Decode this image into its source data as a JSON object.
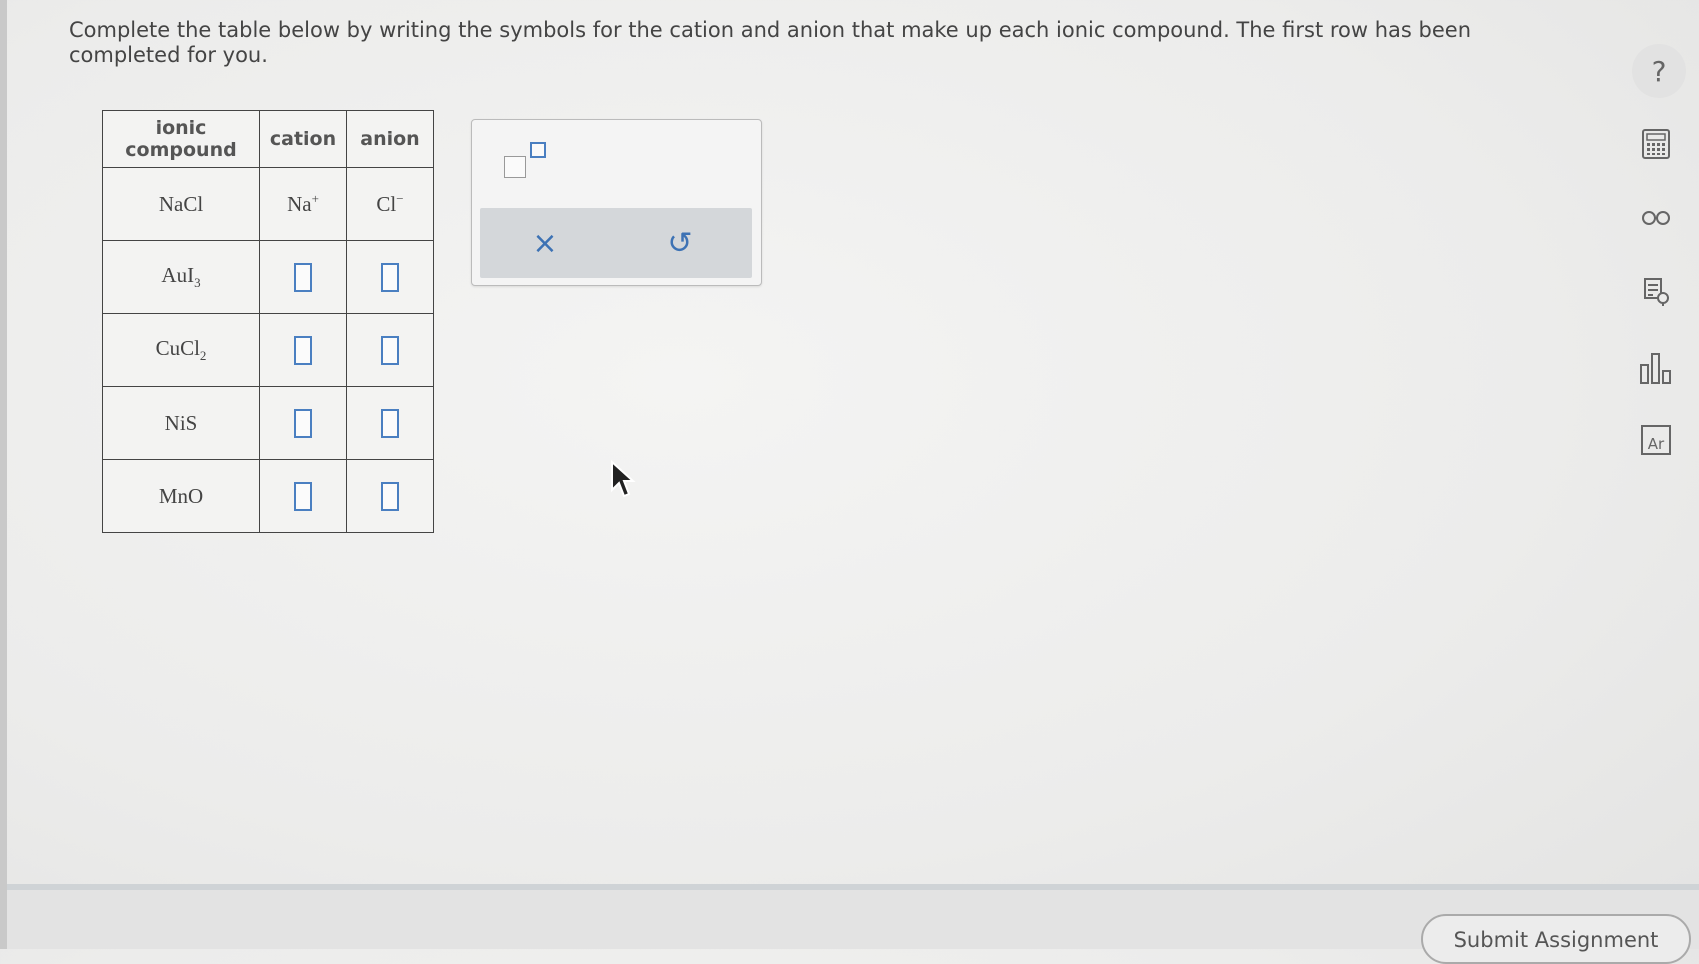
{
  "question": {
    "text": "Complete the table below by writing the symbols for the cation and anion that make up each ionic compound. The first row has been completed for you."
  },
  "table": {
    "headers": {
      "compound_line1": "ionic",
      "compound_line2": "compound",
      "cation": "cation",
      "anion": "anion"
    },
    "example_row": {
      "compound_base": "NaCl",
      "cation_symbol": "Na",
      "cation_charge": "+",
      "anion_symbol": "Cl",
      "anion_charge": "−"
    },
    "rows": [
      {
        "compound_base": "AuI",
        "compound_subscript": "3",
        "cation": "",
        "anion": ""
      },
      {
        "compound_base": "CuCl",
        "compound_subscript": "2",
        "cation": "",
        "anion": ""
      },
      {
        "compound_base": "NiS",
        "compound_subscript": "",
        "cation": "",
        "anion": ""
      },
      {
        "compound_base": "MnO",
        "compound_subscript": "",
        "cation": "",
        "anion": ""
      }
    ]
  },
  "palette": {
    "tools": [
      "superscript-tool"
    ],
    "clear_symbol": "×",
    "undo_symbol": "↺"
  },
  "sidebar": {
    "help_symbol": "?",
    "icons": [
      "calculator-icon",
      "glasses-icon",
      "notes-icon",
      "bar-chart-icon",
      "periodic-table-icon"
    ],
    "periodic_table_label": "Ar"
  },
  "footer": {
    "submit_label": "Submit Assignment"
  },
  "colors": {
    "accent": "#4a7fc1",
    "background": "#ececeb"
  }
}
